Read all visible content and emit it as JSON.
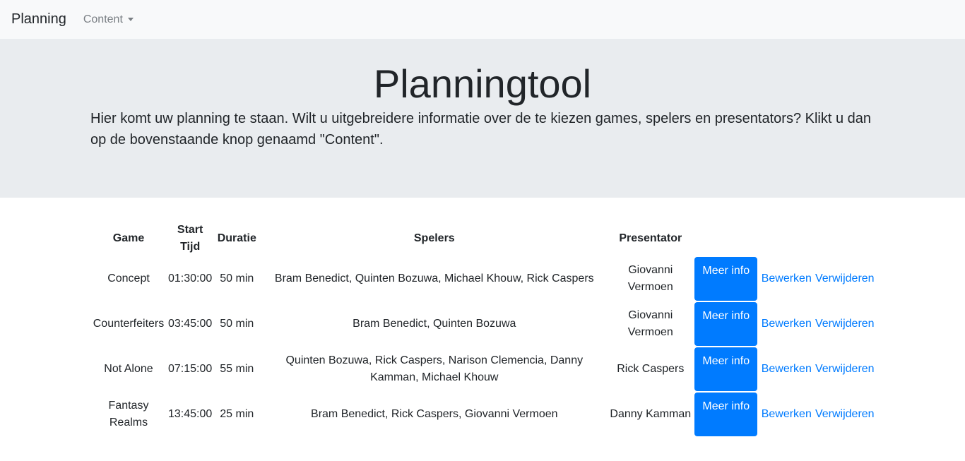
{
  "navbar": {
    "brand": "Planning",
    "menu": "Content"
  },
  "hero": {
    "title": "Planningtool",
    "lead": "Hier komt uw planning te staan. Wilt u uitgebreidere informatie over de te kiezen games, spelers en presentators? Klikt u dan op de bovenstaande knop genaamd \"Content\"."
  },
  "table": {
    "headers": {
      "game": "Game",
      "start": "Start Tijd",
      "duration": "Duratie",
      "players": "Spelers",
      "presenter": "Presentator"
    },
    "rows": [
      {
        "game": "Concept",
        "start": "01:30:00",
        "duration": "50 min",
        "players": "Bram Benedict, Quinten Bozuwa, Michael Khouw, Rick Caspers",
        "presenter": "Giovanni Vermoen"
      },
      {
        "game": "Counterfeiters",
        "start": "03:45:00",
        "duration": "50 min",
        "players": "Bram Benedict, Quinten Bozuwa",
        "presenter": "Giovanni Vermoen"
      },
      {
        "game": "Not Alone",
        "start": "07:15:00",
        "duration": "55 min",
        "players": "Quinten Bozuwa, Rick Caspers, Narison Clemencia, Danny Kamman, Michael Khouw",
        "presenter": "Rick Caspers"
      },
      {
        "game": "Fantasy Realms",
        "start": "13:45:00",
        "duration": "25 min",
        "players": "Bram Benedict, Rick Caspers, Giovanni Vermoen",
        "presenter": "Danny Kamman"
      }
    ],
    "actions": {
      "info": "Meer info",
      "edit": "Bewerken",
      "delete": "Verwijderen"
    }
  },
  "colors": {
    "primary": "#007bff",
    "navbar_bg": "#f8f9fa",
    "jumbotron_bg": "#e9ecef"
  }
}
